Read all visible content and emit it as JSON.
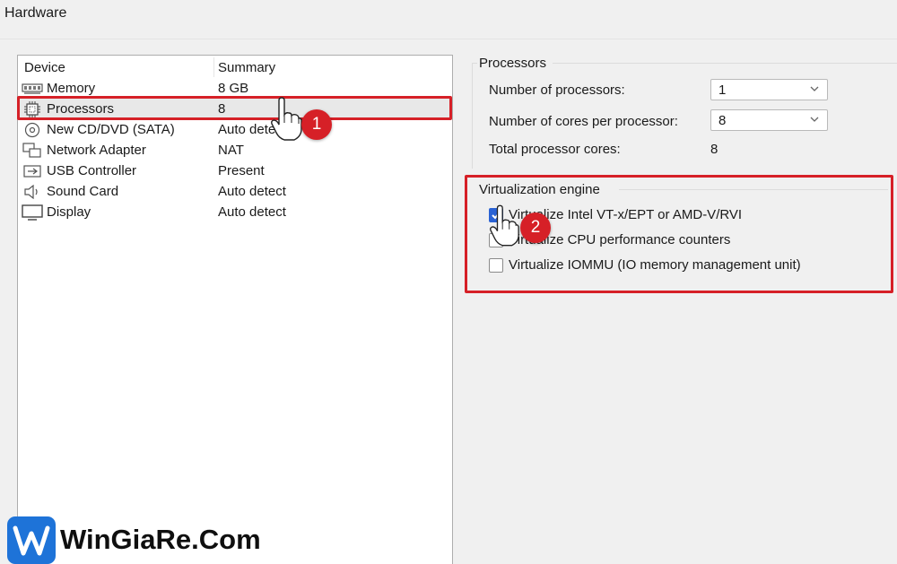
{
  "window": {
    "title": "Hardware"
  },
  "device_list": {
    "columns": [
      "Device",
      "Summary"
    ],
    "rows": [
      {
        "name": "Memory",
        "summary": "8 GB",
        "icon": "memory-icon"
      },
      {
        "name": "Processors",
        "summary": "8",
        "icon": "processor-icon",
        "selected": true
      },
      {
        "name": "New CD/DVD (SATA)",
        "summary": "Auto detect",
        "icon": "cd-dvd-icon"
      },
      {
        "name": "Network Adapter",
        "summary": "NAT",
        "icon": "network-adapter-icon"
      },
      {
        "name": "USB Controller",
        "summary": "Present",
        "icon": "usb-icon"
      },
      {
        "name": "Sound Card",
        "summary": "Auto detect",
        "icon": "speaker-icon"
      },
      {
        "name": "Display",
        "summary": "Auto detect",
        "icon": "display-icon"
      }
    ]
  },
  "processors": {
    "title": "Processors",
    "num_processors_label": "Number of processors:",
    "num_processors_value": "1",
    "cores_label": "Number of cores per processor:",
    "cores_value": "8",
    "total_label": "Total processor cores:",
    "total_value": "8"
  },
  "virtualization": {
    "title": "Virtualization engine",
    "options": [
      {
        "label": "Virtualize Intel VT-x/EPT or AMD-V/RVI",
        "checked": true
      },
      {
        "label": "Virtualize CPU performance counters",
        "checked": false
      },
      {
        "label": "Virtualize IOMMU (IO memory management unit)",
        "checked": false
      }
    ]
  },
  "annotations": {
    "step1": "1",
    "step2": "2",
    "highlight_color": "#d62027"
  },
  "watermark": {
    "text": "WinGiaRe.Com",
    "brand_color": "#1e73d8"
  }
}
